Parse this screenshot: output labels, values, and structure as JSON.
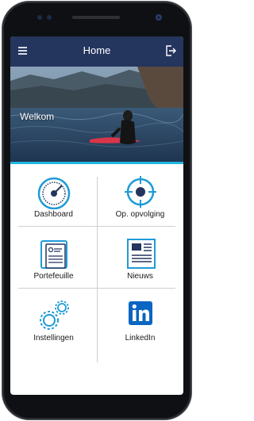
{
  "header": {
    "title": "Home",
    "menu_icon": "hamburger-menu-icon",
    "logout_icon": "logout-icon"
  },
  "hero": {
    "title": "Welkom"
  },
  "tiles": [
    {
      "label": "Dashboard",
      "icon": "speedometer-icon"
    },
    {
      "label": "Op. opvolging",
      "icon": "target-icon"
    },
    {
      "label": "Portefeuille",
      "icon": "portfolio-document-icon"
    },
    {
      "label": "Nieuws",
      "icon": "newspaper-icon"
    },
    {
      "label": "Instellingen",
      "icon": "gears-icon"
    },
    {
      "label": "LinkedIn",
      "icon": "linkedin-icon"
    }
  ],
  "colors": {
    "navbar": "#24355e",
    "accent": "#23b6e3",
    "icon_blue": "#1e9bd7",
    "icon_dark": "#24355e",
    "linkedin": "#0a66c2"
  }
}
